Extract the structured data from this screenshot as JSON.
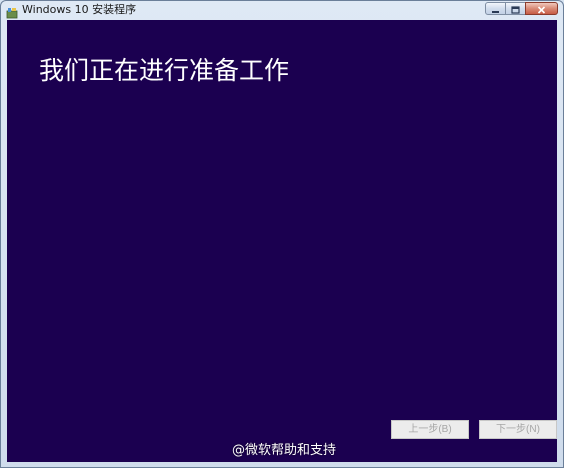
{
  "window": {
    "title": "Windows 10 安装程序",
    "icon": "setup-app-icon",
    "controls": [
      "minimize-icon",
      "maximize-icon",
      "close-icon"
    ]
  },
  "main": {
    "heading": "我们正在进行准备工作",
    "background_color": "#1b0050"
  },
  "footer": {
    "back_label": "上一步(B)",
    "next_label": "下一步(N)",
    "back_enabled": false,
    "next_enabled": false
  },
  "watermark": {
    "text": "@微软帮助和支持"
  }
}
